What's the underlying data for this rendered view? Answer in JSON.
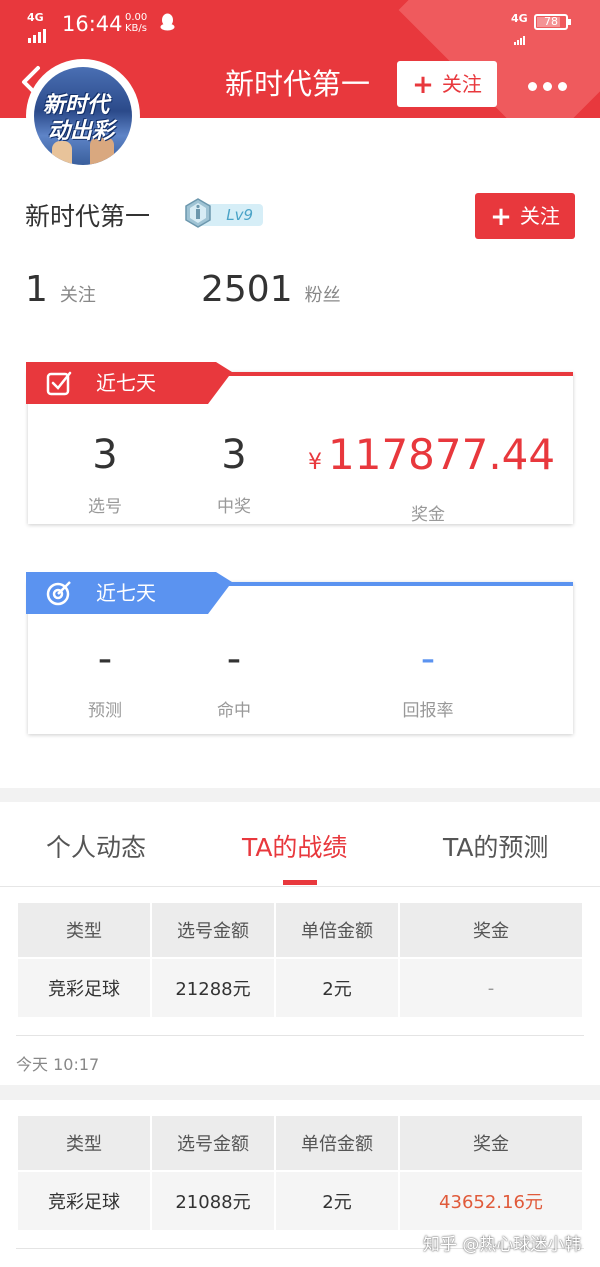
{
  "status_bar": {
    "network": "4G",
    "time": "16:44",
    "speed_value": "0.00",
    "speed_unit": "KB/s",
    "right_network": "4G",
    "battery": "78"
  },
  "nav": {
    "title": "新时代第一",
    "follow_label": "关注"
  },
  "avatar": {
    "line1": "新时代",
    "line2": "动出彩"
  },
  "profile": {
    "name": "新时代第一",
    "level": "Lv9",
    "follow_label": "关注",
    "follow_count": "1",
    "follow_label_text": "关注",
    "fans_count": "2501",
    "fans_label": "粉丝"
  },
  "card_prize": {
    "title": "近七天",
    "picks": "3",
    "picks_label": "选号",
    "wins": "3",
    "wins_label": "中奖",
    "currency": "¥",
    "prize": "117877.44",
    "prize_label": "奖金",
    "accent": "#e8383d"
  },
  "card_predict": {
    "title": "近七天",
    "predict": "-",
    "predict_label": "预测",
    "hit": "-",
    "hit_label": "命中",
    "roi": "-",
    "roi_label": "回报率",
    "accent": "#5b93f0"
  },
  "tabs": [
    {
      "label": "个人动态",
      "active": false
    },
    {
      "label": "TA的战绩",
      "active": true
    },
    {
      "label": "TA的预测",
      "active": false
    }
  ],
  "records": [
    {
      "headers": [
        "类型",
        "选号金额",
        "单倍金额",
        "奖金"
      ],
      "row": [
        "竞彩足球",
        "21288元",
        "2元",
        "-"
      ],
      "time": "今天  10:17"
    },
    {
      "headers": [
        "类型",
        "选号金额",
        "单倍金额",
        "奖金"
      ],
      "row": [
        "竞彩足球",
        "21088元",
        "2元",
        "43652.16元"
      ]
    }
  ],
  "watermark": "知乎 @热心球迷小韩"
}
